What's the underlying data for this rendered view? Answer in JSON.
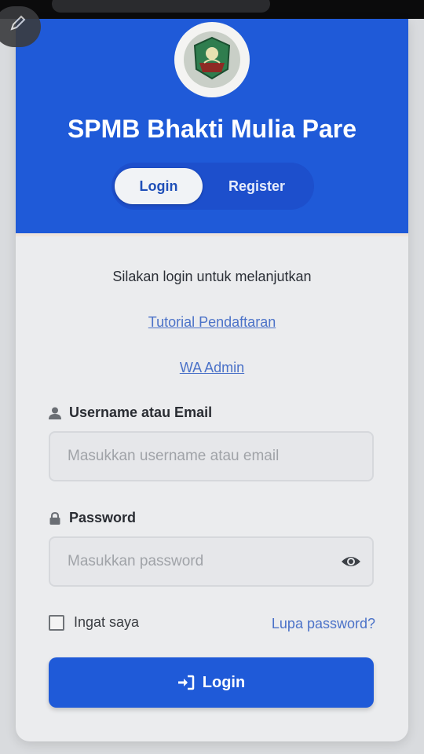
{
  "app": {
    "title": "SPMB Bhakti Mulia Pare"
  },
  "auth_toggle": {
    "login_label": "Login",
    "register_label": "Register",
    "active": "Login"
  },
  "content": {
    "subtitle": "Silakan login untuk melanjutkan",
    "tutorial_link": "Tutorial Pendaftaran",
    "wa_admin_link": "WA Admin"
  },
  "form": {
    "username_label": "Username atau Email",
    "username_placeholder": "Masukkan username atau email",
    "username_value": "",
    "password_label": "Password",
    "password_placeholder": "Masukkan password",
    "password_value": "",
    "remember_label": "Ingat saya",
    "remember_checked": false,
    "forgot_link": "Lupa password?",
    "submit_label": "Login"
  },
  "icons": {
    "username": "user-icon",
    "password": "lock-icon",
    "toggle_password": "eye-icon",
    "submit": "sign-in-icon",
    "edit": "pencil-icon"
  },
  "colors": {
    "primary": "#1f5ad8",
    "link": "#4b72c8",
    "background": "#ebecee"
  }
}
